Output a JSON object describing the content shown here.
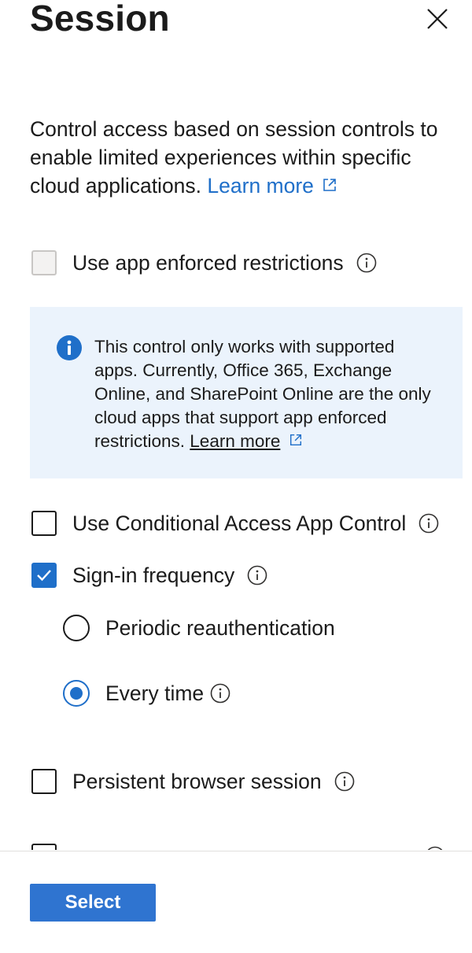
{
  "panel": {
    "title": "Session",
    "description": "Control access based on session controls to enable limited experiences within specific cloud applications.",
    "learn_more": "Learn more"
  },
  "options": {
    "app_enforced": {
      "label": "Use app enforced restrictions",
      "checked": false,
      "disabled": true
    },
    "notice": {
      "text": "This control only works with supported apps. Currently, Office 365, Exchange Online, and SharePoint Online are the only cloud apps that support app enforced restrictions.",
      "link": "Learn more"
    },
    "ca_app_control": {
      "label": "Use Conditional Access App Control",
      "checked": false
    },
    "sign_in_frequency": {
      "label": "Sign-in frequency",
      "checked": true,
      "radios": [
        {
          "label": "Periodic reauthentication",
          "selected": false
        },
        {
          "label": "Every time",
          "selected": true
        }
      ]
    },
    "persistent_browser": {
      "label": "Persistent browser session",
      "checked": false
    }
  },
  "footer": {
    "select_label": "Select"
  },
  "colors": {
    "accent": "#1f6fc9",
    "notice_bg": "#ebf3fc",
    "button": "#2f74d0"
  },
  "icons": [
    "close-icon",
    "external-link-icon",
    "info-icon",
    "checkmark-icon"
  ]
}
